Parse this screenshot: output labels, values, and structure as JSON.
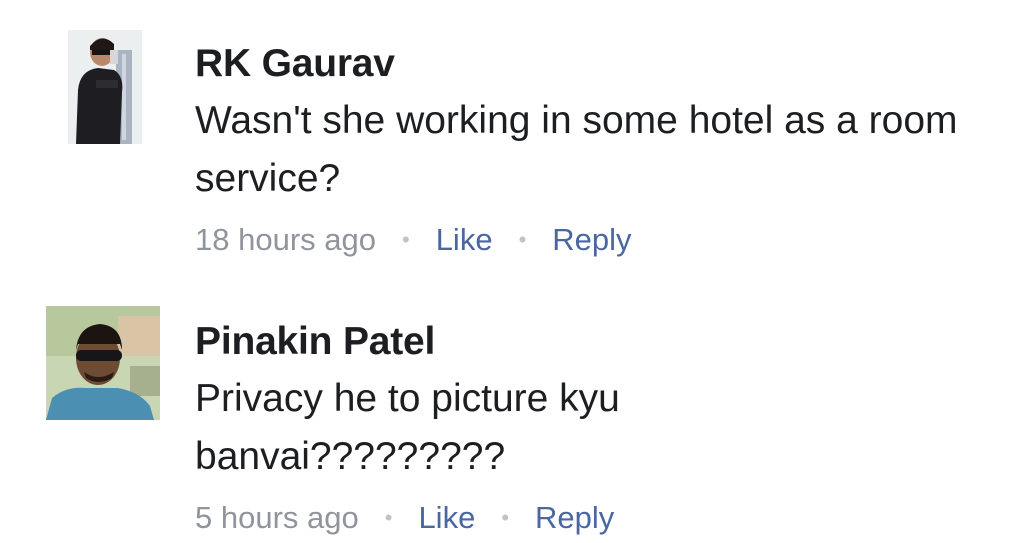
{
  "comments": [
    {
      "author": "RK Gaurav",
      "text": "Wasn't she working in some hotel as a room service?",
      "time": "18 hours ago",
      "like_label": "Like",
      "reply_label": "Reply",
      "avatar_icon": "user-photo-avatar"
    },
    {
      "author": "Pinakin Patel",
      "text": "Privacy he to picture kyu banvai?????????",
      "time": "5 hours ago",
      "like_label": "Like",
      "reply_label": "Reply",
      "avatar_icon": "user-photo-avatar"
    }
  ],
  "separator": "•",
  "colors": {
    "text": "#1c1e21",
    "meta": "#90949c",
    "action": "#4b67a1"
  }
}
